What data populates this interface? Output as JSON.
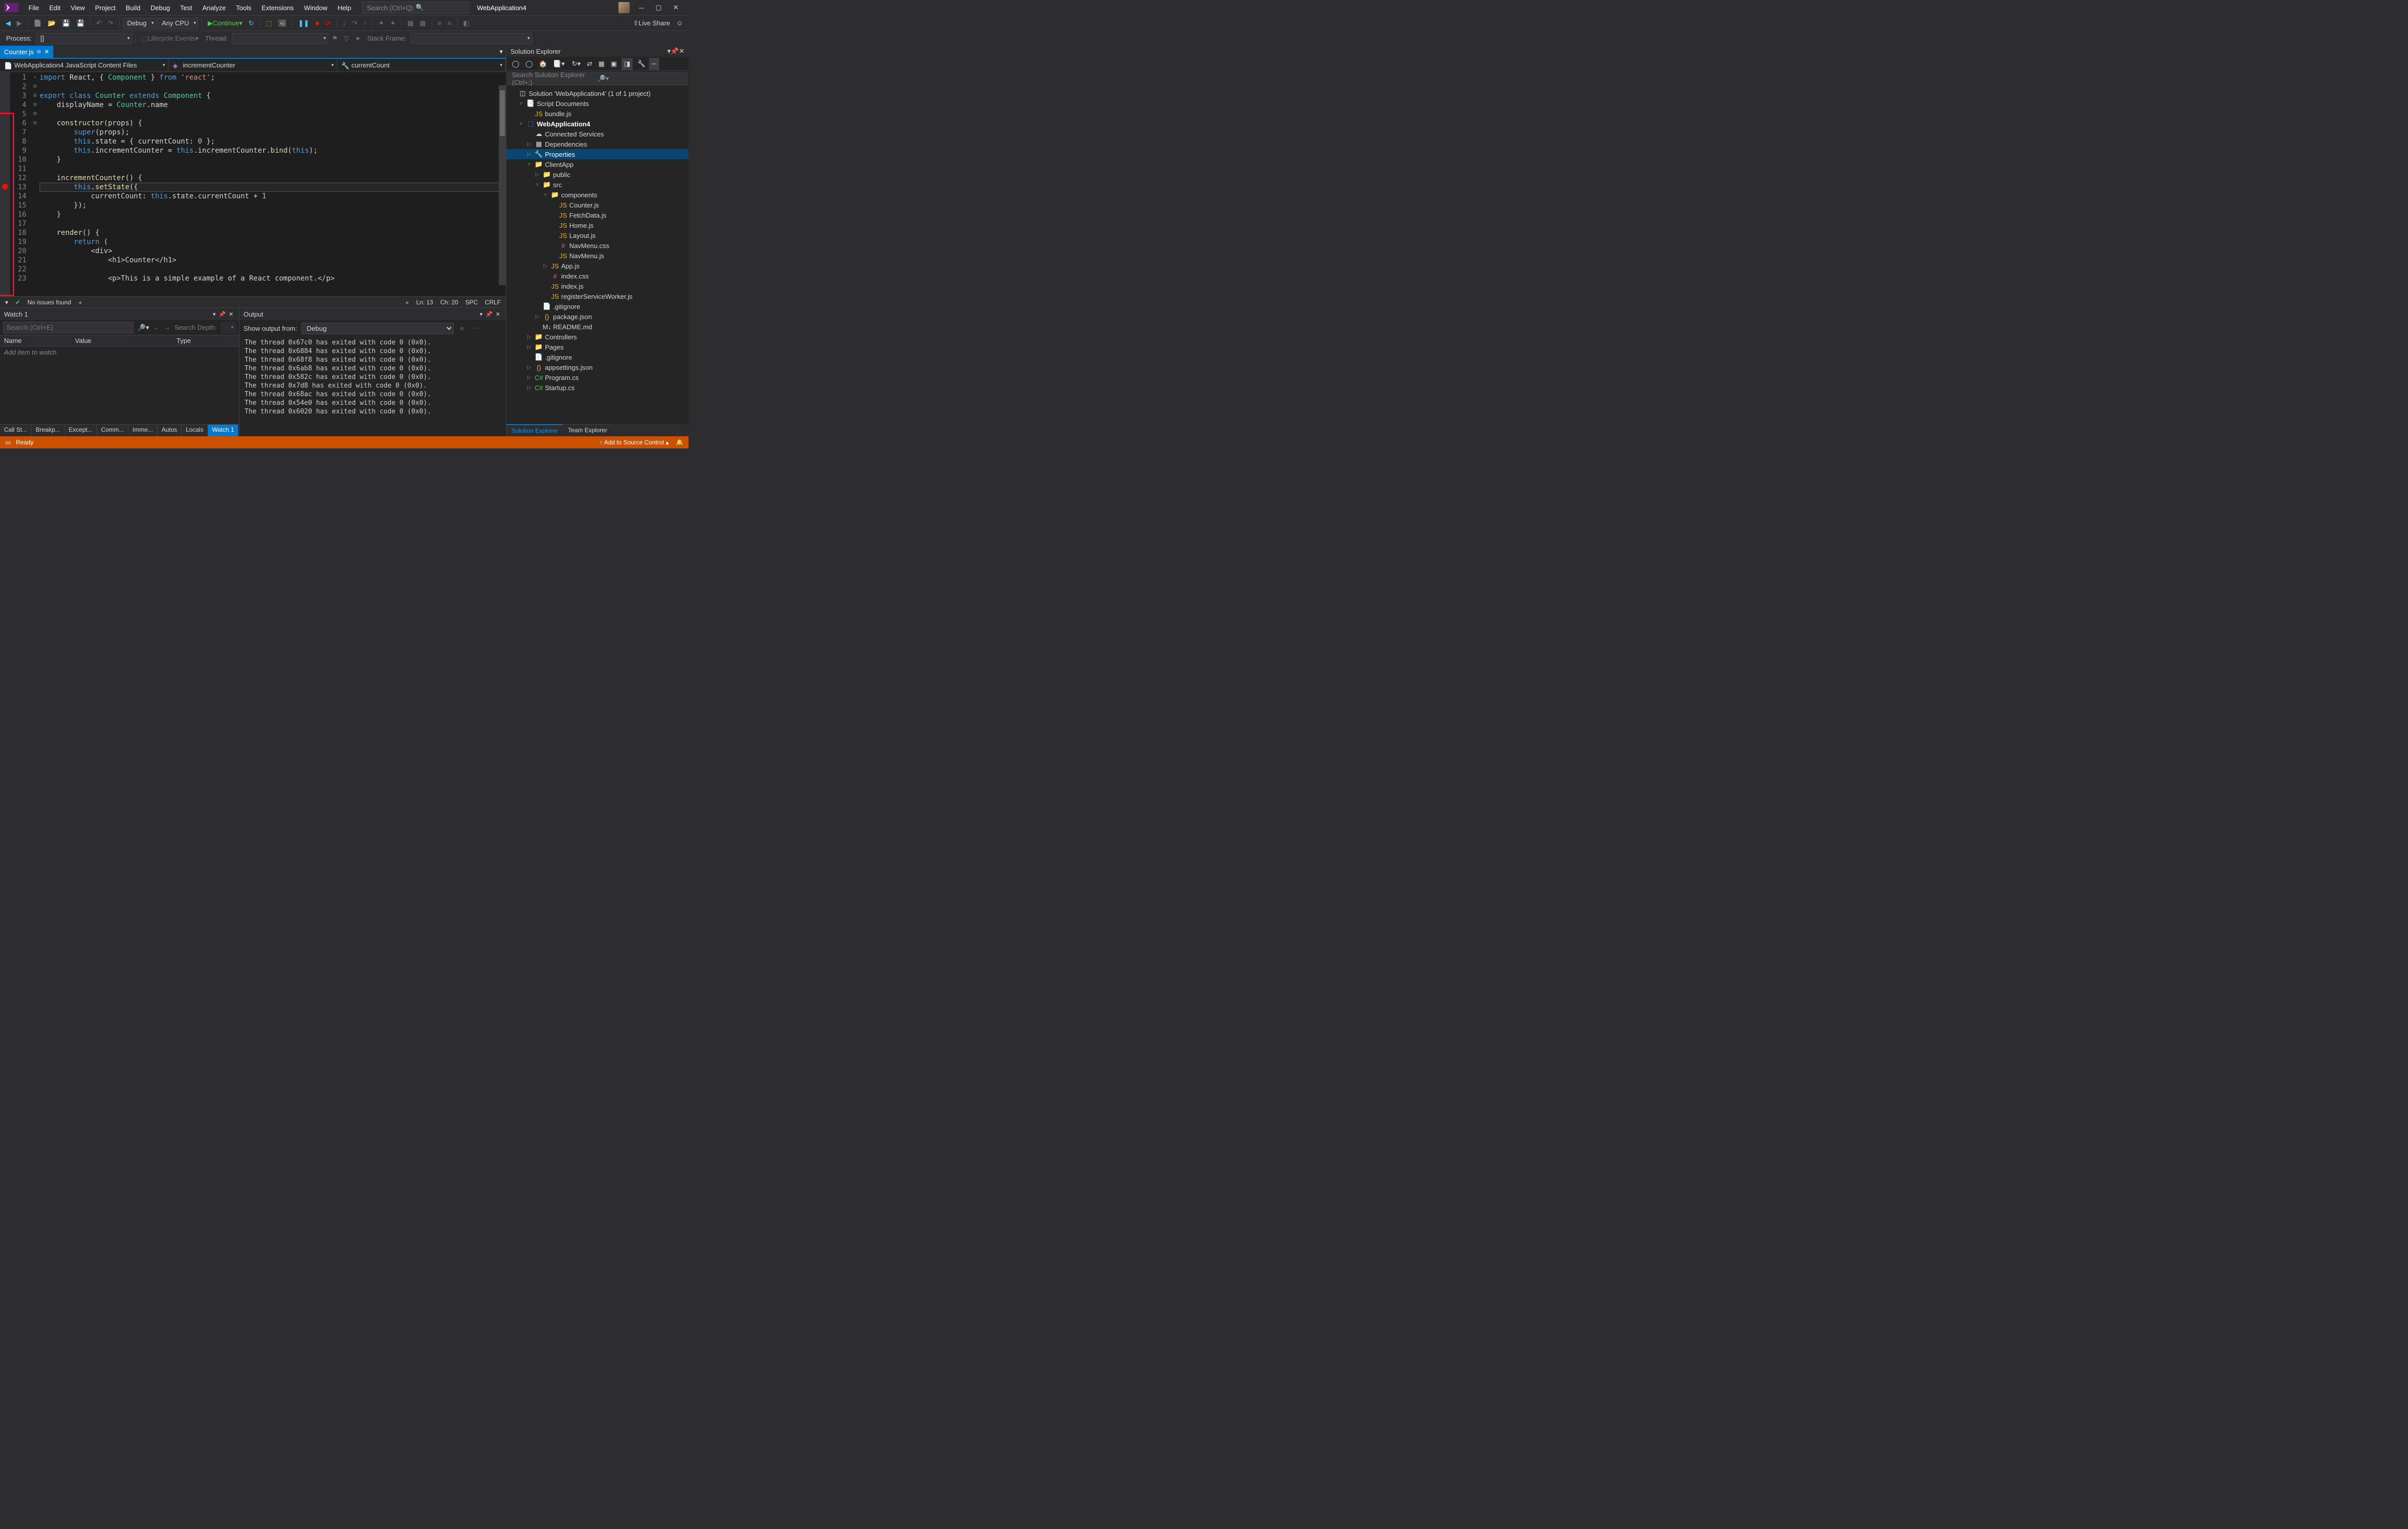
{
  "title": {
    "app": "WebApplication4",
    "searchPlaceholder": "Search (Ctrl+Q)"
  },
  "menu": [
    "File",
    "Edit",
    "View",
    "Project",
    "Build",
    "Debug",
    "Test",
    "Analyze",
    "Tools",
    "Extensions",
    "Window",
    "Help"
  ],
  "toolbar": {
    "config": "Debug",
    "platform": "Any CPU",
    "continue": "Continue",
    "lifecycle": "Lifecycle Events",
    "thread": "Thread:",
    "process": "Process:",
    "stackframe": "Stack Frame:",
    "liveshare": "Live Share"
  },
  "editor": {
    "tab": {
      "name": "Counter.js"
    },
    "nav": {
      "file": "WebApplication4 JavaScript Content Files",
      "member1": "incrementCounter",
      "member2": "currentCount"
    },
    "breakpointLine": 13,
    "lines": [
      {
        "n": 1,
        "html": "<span class='kw'>import</span> React, { <span class='cls'>Component</span> } <span class='kw'>from</span> <span class='str'>'react'</span>;"
      },
      {
        "n": 2,
        "html": ""
      },
      {
        "n": 3,
        "html": "<span class='kw'>export</span> <span class='kw'>class</span> <span class='cls'>Counter</span> <span class='kw'>extends</span> <span class='cls'>Component</span> {",
        "fold": "−"
      },
      {
        "n": 4,
        "html": "    displayName = <span class='cls'>Counter</span>.name"
      },
      {
        "n": 5,
        "html": ""
      },
      {
        "n": 6,
        "html": "    <span class='fn'>constructor</span>(props) {",
        "fold": "⊟"
      },
      {
        "n": 7,
        "html": "        <span class='kw'>super</span>(props);"
      },
      {
        "n": 8,
        "html": "        <span class='kw'>this</span>.state = { currentCount: <span class='num'>0</span> };"
      },
      {
        "n": 9,
        "html": "        <span class='kw'>this</span>.incrementCounter = <span class='kw'>this</span>.incrementCounter.<span class='fn'>bind</span>(<span class='kw'>this</span>);"
      },
      {
        "n": 10,
        "html": "    }"
      },
      {
        "n": 11,
        "html": ""
      },
      {
        "n": 12,
        "html": "    <span class='fn'>incrementCounter</span>() {",
        "fold": "⊟"
      },
      {
        "n": 13,
        "html": "        <span class='kw'>this</span>.<span class='fn'>setState</span>({",
        "fold": "⊟"
      },
      {
        "n": 14,
        "html": "            currentCount: <span class='kw'>this</span>.state.currentCount + <span class='num'>1</span>"
      },
      {
        "n": 15,
        "html": "        });"
      },
      {
        "n": 16,
        "html": "    }"
      },
      {
        "n": 17,
        "html": ""
      },
      {
        "n": 18,
        "html": "    <span class='fn'>render</span>() {",
        "fold": "⊟"
      },
      {
        "n": 19,
        "html": "        <span class='kw'>return</span> ("
      },
      {
        "n": 20,
        "html": "            &lt;div&gt;",
        "fold": "⊟"
      },
      {
        "n": 21,
        "html": "                &lt;h1&gt;Counter&lt;/h1&gt;"
      },
      {
        "n": 22,
        "html": ""
      },
      {
        "n": 23,
        "html": "                &lt;p&gt;This is a simple example of a React component.&lt;/p&gt;"
      }
    ],
    "status": {
      "issues": "No issues found",
      "ln": "Ln: 13",
      "ch": "Ch: 20",
      "spc": "SPC",
      "crlf": "CRLF"
    }
  },
  "watch": {
    "title": "Watch 1",
    "searchPlaceholder": "Search (Ctrl+E)",
    "depthLabel": "Search Depth:",
    "cols": [
      "Name",
      "Value",
      "Type"
    ],
    "empty": "Add item to watch",
    "tabs": [
      "Call St...",
      "Breakp...",
      "Except...",
      "Comm...",
      "Imme...",
      "Autos",
      "Locals",
      "Watch 1"
    ],
    "activeTab": 7
  },
  "output": {
    "title": "Output",
    "fromLabel": "Show output from:",
    "source": "Debug",
    "lines": [
      "The thread 0x67c0 has exited with code 0 (0x0).",
      "The thread 0x6884 has exited with code 0 (0x0).",
      "The thread 0x68f8 has exited with code 0 (0x0).",
      "The thread 0x6ab8 has exited with code 0 (0x0).",
      "The thread 0x582c has exited with code 0 (0x0).",
      "The thread 0x7d8 has exited with code 0 (0x0).",
      "The thread 0x68ac has exited with code 0 (0x0).",
      "The thread 0x54e0 has exited with code 0 (0x0).",
      "The thread 0x6020 has exited with code 0 (0x0)."
    ]
  },
  "solution": {
    "title": "Solution Explorer",
    "searchPlaceholder": "Search Solution Explorer (Ctrl+;)",
    "tree": [
      {
        "d": 0,
        "exp": "",
        "icon": "sln",
        "label": "Solution 'WebApplication4' (1 of 1 project)"
      },
      {
        "d": 1,
        "exp": "▿",
        "icon": "docs",
        "label": "Script Documents"
      },
      {
        "d": 2,
        "exp": "",
        "icon": "js",
        "label": "bundle.js"
      },
      {
        "d": 1,
        "exp": "▿",
        "icon": "proj",
        "label": "WebApplication4",
        "bold": true
      },
      {
        "d": 2,
        "exp": "",
        "icon": "svc",
        "label": "Connected Services"
      },
      {
        "d": 2,
        "exp": "▷",
        "icon": "dep",
        "label": "Dependencies"
      },
      {
        "d": 2,
        "exp": "▷",
        "icon": "wrench",
        "label": "Properties",
        "sel": true
      },
      {
        "d": 2,
        "exp": "▿",
        "icon": "folder",
        "label": "ClientApp"
      },
      {
        "d": 3,
        "exp": "▷",
        "icon": "folder",
        "label": "public"
      },
      {
        "d": 3,
        "exp": "▿",
        "icon": "folder",
        "label": "src"
      },
      {
        "d": 4,
        "exp": "▿",
        "icon": "folder",
        "label": "components"
      },
      {
        "d": 5,
        "exp": "",
        "icon": "js",
        "label": "Counter.js"
      },
      {
        "d": 5,
        "exp": "",
        "icon": "js",
        "label": "FetchData.js"
      },
      {
        "d": 5,
        "exp": "",
        "icon": "js",
        "label": "Home.js"
      },
      {
        "d": 5,
        "exp": "",
        "icon": "js",
        "label": "Layout.js"
      },
      {
        "d": 5,
        "exp": "",
        "icon": "css",
        "label": "NavMenu.css"
      },
      {
        "d": 5,
        "exp": "",
        "icon": "js",
        "label": "NavMenu.js"
      },
      {
        "d": 4,
        "exp": "▷",
        "icon": "js",
        "label": "App.js"
      },
      {
        "d": 4,
        "exp": "",
        "icon": "css",
        "label": "index.css"
      },
      {
        "d": 4,
        "exp": "",
        "icon": "js",
        "label": "index.js"
      },
      {
        "d": 4,
        "exp": "",
        "icon": "js",
        "label": "registerServiceWorker.js"
      },
      {
        "d": 3,
        "exp": "",
        "icon": "file",
        "label": ".gitignore"
      },
      {
        "d": 3,
        "exp": "▷",
        "icon": "json",
        "label": "package.json"
      },
      {
        "d": 3,
        "exp": "",
        "icon": "md",
        "label": "README.md"
      },
      {
        "d": 2,
        "exp": "▷",
        "icon": "folder",
        "label": "Controllers"
      },
      {
        "d": 2,
        "exp": "▷",
        "icon": "folder",
        "label": "Pages"
      },
      {
        "d": 2,
        "exp": "",
        "icon": "file",
        "label": ".gitignore"
      },
      {
        "d": 2,
        "exp": "▷",
        "icon": "json",
        "label": "appsettings.json"
      },
      {
        "d": 2,
        "exp": "▷",
        "icon": "cs",
        "label": "Program.cs"
      },
      {
        "d": 2,
        "exp": "▷",
        "icon": "cs",
        "label": "Startup.cs"
      }
    ],
    "tabs": [
      "Solution Explorer",
      "Team Explorer"
    ],
    "activeTab": 0
  },
  "statusbar": {
    "ready": "Ready",
    "sourceControl": "Add to Source Control"
  }
}
